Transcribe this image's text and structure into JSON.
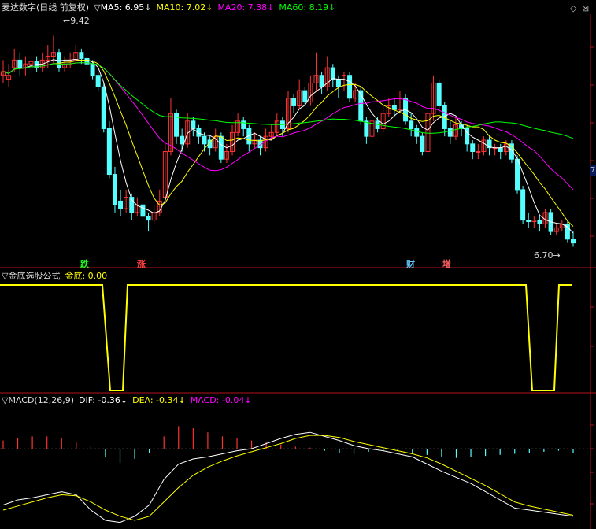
{
  "header": {
    "title": "麦达数字(日线 前复权)",
    "ma5": {
      "label": "MA5: 6.95",
      "arrow": "↓",
      "color": "#ffffff"
    },
    "ma10": {
      "label": "MA10: 7.02",
      "arrow": "↓",
      "color": "#ffff00"
    },
    "ma20": {
      "label": "MA20: 7.38",
      "arrow": "↓",
      "color": "#ff00ff"
    },
    "ma60": {
      "label": "MA60: 8.19",
      "arrow": "↓",
      "color": "#00ff00"
    }
  },
  "window_buttons": {
    "restore": "◇",
    "close": "⊠"
  },
  "markers": {
    "fall": "跌",
    "rise": "涨",
    "finance": "财",
    "add": "增"
  },
  "price_labels": {
    "high": "9.42",
    "low": "6.70",
    "arrow": "←",
    "arrow_right": "→"
  },
  "side_badge": "7",
  "indicator": {
    "title": "▽金底选股公式",
    "value_label": "金底: 0.00"
  },
  "macd_header": {
    "title": "▽MACD(12,26,9)",
    "dif": "DIF: -0.36",
    "dif_arrow": "↓",
    "dea": "DEA: -0.34",
    "dea_arrow": "↓",
    "macd": "MACD: -0.04",
    "macd_arrow": "↓"
  },
  "colors": {
    "up": "#ff3232",
    "down": "#54ffff",
    "ma5": "#ffffff",
    "ma10": "#ffff00",
    "ma20": "#ff00ff",
    "ma60": "#00ff00",
    "frame": "#b4141e",
    "signal": "#ffff00"
  },
  "chart_data": [
    {
      "type": "candlestick",
      "title": "麦达数字(日线 前复权)",
      "ylim": [
        6.5,
        9.6
      ],
      "close": [
        8.95,
        8.9,
        9.1,
        9.0,
        9.05,
        9.08,
        9.0,
        9.1,
        9.15,
        9.2,
        9.0,
        9.05,
        9.1,
        9.2,
        9.12,
        9.05,
        8.9,
        8.75,
        8.2,
        7.6,
        7.2,
        7.15,
        7.3,
        7.1,
        7.2,
        7.05,
        7.0,
        7.1,
        7.25,
        7.9,
        8.4,
        8.1,
        8.0,
        8.3,
        8.2,
        8.1,
        8.0,
        7.95,
        8.1,
        7.8,
        7.9,
        8.15,
        8.3,
        8.2,
        8.0,
        8.05,
        7.95,
        8.1,
        8.15,
        8.3,
        8.2,
        8.6,
        8.5,
        8.7,
        8.55,
        8.8,
        8.9,
        8.75,
        9.0,
        8.85,
        8.75,
        8.9,
        8.6,
        8.7,
        8.3,
        8.1,
        8.3,
        8.2,
        8.4,
        8.5,
        8.45,
        8.6,
        8.3,
        8.2,
        8.1,
        7.9,
        8.4,
        8.8,
        8.5,
        8.2,
        8.1,
        8.25,
        8.2,
        8.0,
        7.9,
        7.9,
        8.05,
        7.95,
        7.95,
        7.9,
        8.0,
        7.8,
        7.4,
        7.0,
        6.98,
        7.0,
        6.95,
        7.1,
        6.85,
        6.9,
        6.95,
        6.75,
        6.7
      ],
      "open": [
        8.9,
        8.85,
        9.0,
        9.1,
        9.0,
        9.05,
        9.08,
        9.0,
        9.1,
        9.15,
        9.2,
        9.0,
        9.05,
        9.1,
        9.2,
        9.12,
        9.05,
        8.9,
        8.75,
        8.2,
        7.6,
        7.25,
        7.15,
        7.3,
        7.1,
        7.2,
        7.05,
        7.0,
        7.1,
        7.3,
        7.9,
        8.4,
        8.1,
        8.0,
        8.3,
        8.2,
        8.1,
        8.05,
        7.95,
        8.1,
        7.8,
        7.9,
        8.15,
        8.3,
        8.2,
        8.0,
        8.05,
        7.95,
        8.1,
        8.15,
        8.3,
        8.2,
        8.6,
        8.5,
        8.7,
        8.55,
        8.8,
        8.9,
        8.75,
        9.0,
        8.85,
        8.75,
        8.9,
        8.6,
        8.7,
        8.3,
        8.1,
        8.3,
        8.2,
        8.4,
        8.5,
        8.45,
        8.6,
        8.3,
        8.2,
        8.1,
        7.9,
        8.4,
        8.8,
        8.5,
        8.2,
        8.1,
        8.25,
        8.2,
        8.0,
        7.9,
        7.9,
        8.05,
        7.95,
        7.95,
        7.9,
        8.0,
        7.8,
        7.4,
        7.0,
        6.98,
        7.0,
        6.95,
        7.1,
        6.85,
        6.9,
        6.95,
        6.75
      ],
      "high": [
        9.1,
        9.05,
        9.25,
        9.2,
        9.15,
        9.2,
        9.15,
        9.2,
        9.3,
        9.42,
        9.25,
        9.15,
        9.2,
        9.3,
        9.25,
        9.2,
        9.1,
        8.95,
        8.8,
        8.3,
        7.7,
        7.4,
        7.4,
        7.35,
        7.3,
        7.25,
        7.1,
        7.2,
        7.4,
        8.0,
        8.6,
        8.45,
        8.2,
        8.4,
        8.35,
        8.25,
        8.15,
        8.1,
        8.2,
        8.15,
        8.0,
        8.25,
        8.4,
        8.35,
        8.25,
        8.15,
        8.1,
        8.2,
        8.25,
        8.4,
        8.35,
        8.7,
        8.65,
        8.85,
        8.75,
        8.9,
        9.2,
        8.95,
        9.15,
        9.05,
        8.9,
        8.95,
        8.95,
        8.8,
        8.75,
        8.35,
        8.4,
        8.35,
        8.5,
        8.6,
        8.6,
        8.7,
        8.65,
        8.4,
        8.25,
        8.15,
        8.5,
        8.9,
        8.85,
        8.55,
        8.3,
        8.35,
        8.3,
        8.25,
        8.05,
        8.0,
        8.1,
        8.1,
        8.0,
        8.0,
        8.05,
        8.05,
        7.85,
        7.45,
        7.1,
        7.05,
        7.05,
        7.15,
        7.15,
        6.95,
        7.0,
        7.0,
        6.85
      ],
      "low": [
        8.8,
        8.75,
        8.95,
        8.9,
        8.9,
        8.95,
        8.95,
        8.95,
        9.0,
        9.05,
        8.95,
        8.95,
        9.0,
        9.05,
        9.05,
        8.95,
        8.85,
        8.7,
        8.15,
        7.55,
        7.1,
        7.05,
        7.1,
        7.0,
        7.05,
        7.0,
        6.85,
        6.95,
        7.05,
        7.25,
        7.85,
        8.0,
        7.9,
        7.95,
        8.1,
        8.0,
        7.9,
        7.85,
        7.9,
        7.75,
        7.75,
        7.85,
        8.1,
        8.1,
        7.9,
        7.95,
        7.85,
        7.9,
        8.05,
        8.1,
        8.1,
        8.15,
        8.4,
        8.45,
        8.5,
        8.5,
        8.7,
        8.65,
        8.7,
        8.75,
        8.6,
        8.7,
        8.55,
        8.55,
        8.25,
        8.0,
        8.05,
        8.15,
        8.15,
        8.35,
        8.35,
        8.4,
        8.25,
        8.1,
        8.0,
        7.85,
        7.85,
        8.3,
        8.4,
        8.1,
        8.0,
        8.05,
        8.1,
        7.9,
        7.8,
        7.8,
        7.85,
        7.85,
        7.85,
        7.8,
        7.85,
        7.75,
        7.35,
        6.95,
        6.9,
        6.9,
        6.85,
        6.9,
        6.8,
        6.8,
        6.85,
        6.7,
        6.65
      ]
    },
    {
      "type": "line",
      "title": "金底选股公式",
      "series": [
        {
          "name": "金底",
          "values_by_x": {
            "0": 1,
            "130": 1,
            "140": 0,
            "156": 0,
            "162": 1,
            "668": 1,
            "676": 0,
            "704": 0,
            "710": 1,
            "727": 1
          }
        }
      ],
      "ylim": [
        0,
        1
      ]
    },
    {
      "type": "line",
      "title": "MACD(12,26,9)",
      "series": [
        {
          "name": "DIF",
          "values": [
            -0.55,
            -0.5,
            -0.48,
            -0.45,
            -0.42,
            -0.45,
            -0.6,
            -0.7,
            -0.72,
            -0.66,
            -0.55,
            -0.3,
            -0.15,
            -0.1,
            -0.08,
            -0.05,
            -0.02,
            0.0,
            0.05,
            0.1,
            0.14,
            0.16,
            0.12,
            0.08,
            0.03,
            0.0,
            -0.02,
            -0.05,
            -0.08,
            -0.15,
            -0.22,
            -0.28,
            -0.34,
            -0.42,
            -0.5,
            -0.58,
            -0.6,
            -0.62,
            -0.64,
            -0.66
          ]
        },
        {
          "name": "DEA",
          "values": [
            -0.6,
            -0.56,
            -0.52,
            -0.48,
            -0.45,
            -0.46,
            -0.52,
            -0.6,
            -0.66,
            -0.7,
            -0.66,
            -0.52,
            -0.38,
            -0.26,
            -0.18,
            -0.12,
            -0.07,
            -0.03,
            0.01,
            0.05,
            0.1,
            0.13,
            0.13,
            0.11,
            0.07,
            0.04,
            0.01,
            -0.02,
            -0.05,
            -0.09,
            -0.15,
            -0.22,
            -0.29,
            -0.36,
            -0.44,
            -0.52,
            -0.56,
            -0.59,
            -0.62,
            -0.65
          ]
        }
      ],
      "macd_bar_values": [
        0.08,
        0.1,
        0.12,
        0.12,
        0.1,
        0.06,
        0.02,
        -0.08,
        -0.14,
        -0.1,
        -0.04,
        0.12,
        0.22,
        0.2,
        0.16,
        0.12,
        0.1,
        0.08,
        0.06,
        0.04,
        0.02,
        0.01,
        -0.02,
        -0.04,
        -0.05,
        -0.03,
        -0.02,
        -0.02,
        -0.04,
        -0.06,
        -0.08,
        -0.09,
        -0.08,
        -0.07,
        -0.06,
        -0.05,
        -0.04,
        -0.03,
        -0.02,
        -0.04
      ]
    }
  ]
}
